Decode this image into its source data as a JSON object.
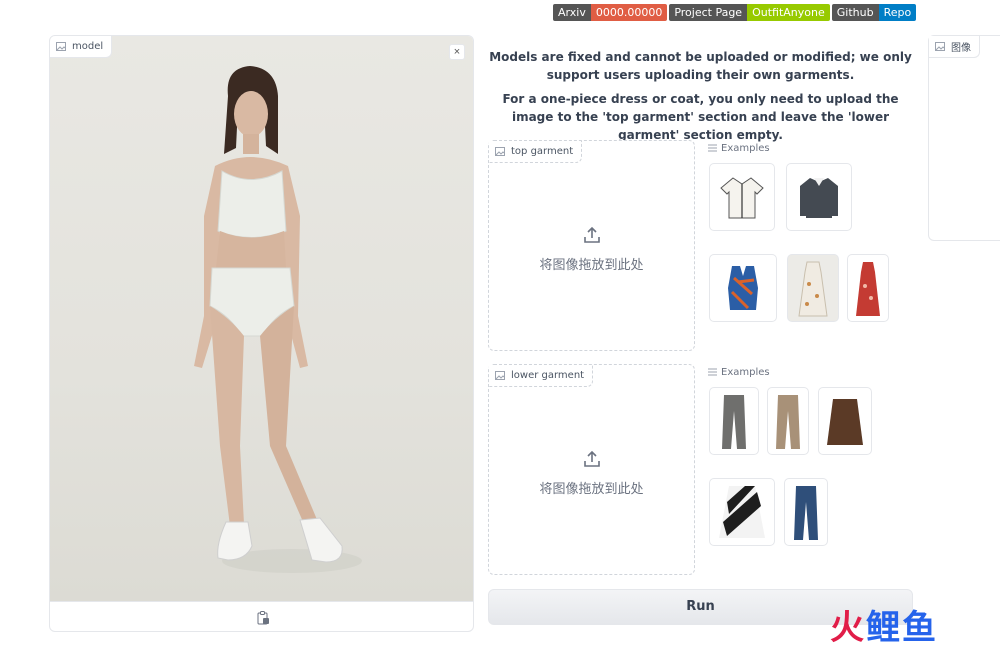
{
  "badges": [
    {
      "left": "Arxiv",
      "right": "0000.00000",
      "right_color": "#e05d44"
    },
    {
      "left": "Project Page",
      "right": "OutfitAnyone",
      "right_color": "#97ca00"
    },
    {
      "left": "Github",
      "right": "Repo",
      "right_color": "#007ec6"
    }
  ],
  "model_panel": {
    "label": "model",
    "close_symbol": "×"
  },
  "description": {
    "line1": "Models are fixed and cannot be uploaded or modified; we only support users uploading their own garments.",
    "line2": "For a one-piece dress or coat, you only need to upload the image to the 'top garment' section and leave the 'lower garment' section empty."
  },
  "top_garment": {
    "label": "top garment",
    "drop_text": "将图像拖放到此处",
    "examples_label": "Examples",
    "examples": [
      "cream-cardigan",
      "grey-polo-sweater",
      "patterned-vest",
      "floral-dress-cream",
      "red-floral-dress"
    ]
  },
  "lower_garment": {
    "label": "lower garment",
    "drop_text": "将图像拖放到此处",
    "examples_label": "Examples",
    "examples": [
      "grey-trousers",
      "beige-trousers",
      "brown-leather-skirt",
      "striped-skirt",
      "blue-jeans"
    ]
  },
  "run_button": {
    "label": "Run"
  },
  "side_panel": {
    "label": "图像"
  },
  "watermark": {
    "c1": "火",
    "c2": "鲤",
    "c3": "鱼"
  },
  "colors": {
    "border": "#e5e7eb",
    "text": "#374151",
    "muted": "#6b7280"
  }
}
